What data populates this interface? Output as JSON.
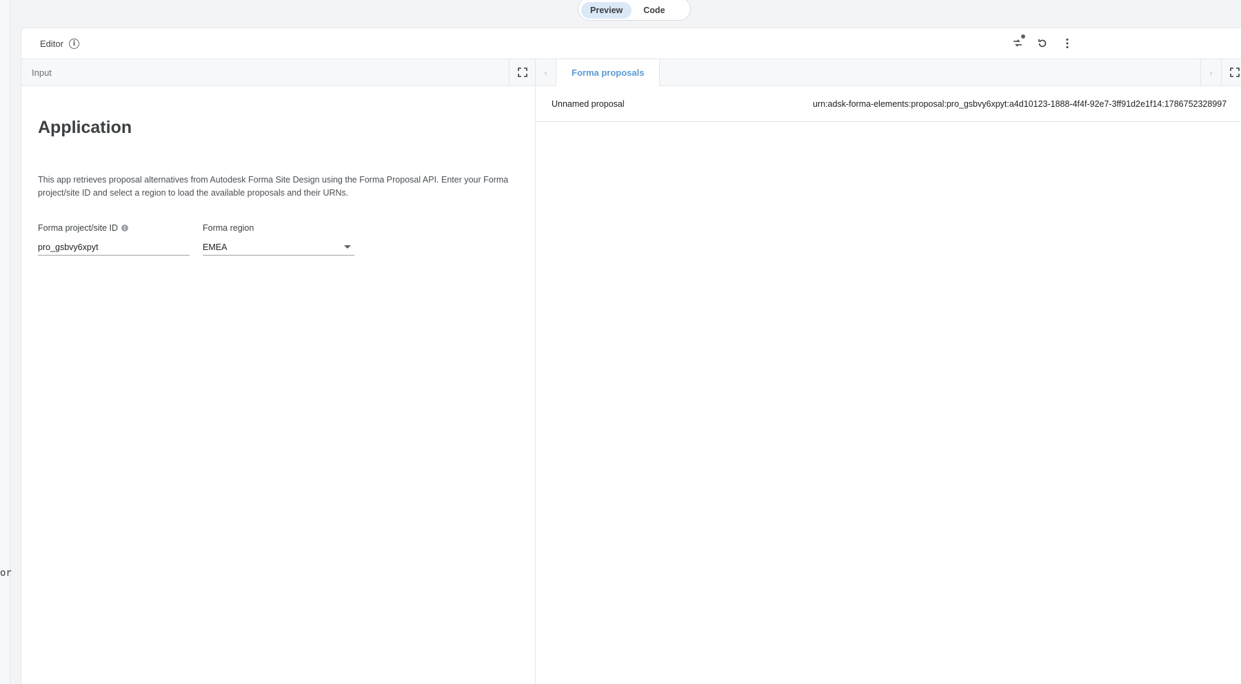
{
  "gutter": {
    "text": "or"
  },
  "view_toggle": {
    "preview_label": "Preview",
    "code_label": "Code",
    "active": "Preview"
  },
  "editor": {
    "title": "Editor"
  },
  "input_pane": {
    "label": "Input",
    "app_title": "Application",
    "description": "This app retrieves proposal alternatives from Autodesk Forma Site Design using the Forma Proposal API. Enter your Forma project/site ID and select a region to load the available proposals and their URNs.",
    "project_field": {
      "label": "Forma project/site ID",
      "value": "pro_gsbvy6xpyt"
    },
    "region_field": {
      "label": "Forma region",
      "value": "EMEA"
    }
  },
  "output_pane": {
    "tab_label": "Forma proposals",
    "proposals": [
      {
        "name": "Unnamed proposal",
        "urn": "urn:adsk-forma-elements:proposal:pro_gsbvy6xpyt:a4d10123-1888-4f4f-92e7-3ff91d2e1f14:1786752328997"
      }
    ]
  },
  "colors": {
    "accent": "#5b9bd5",
    "toggle_active": "#dbe8f7"
  }
}
